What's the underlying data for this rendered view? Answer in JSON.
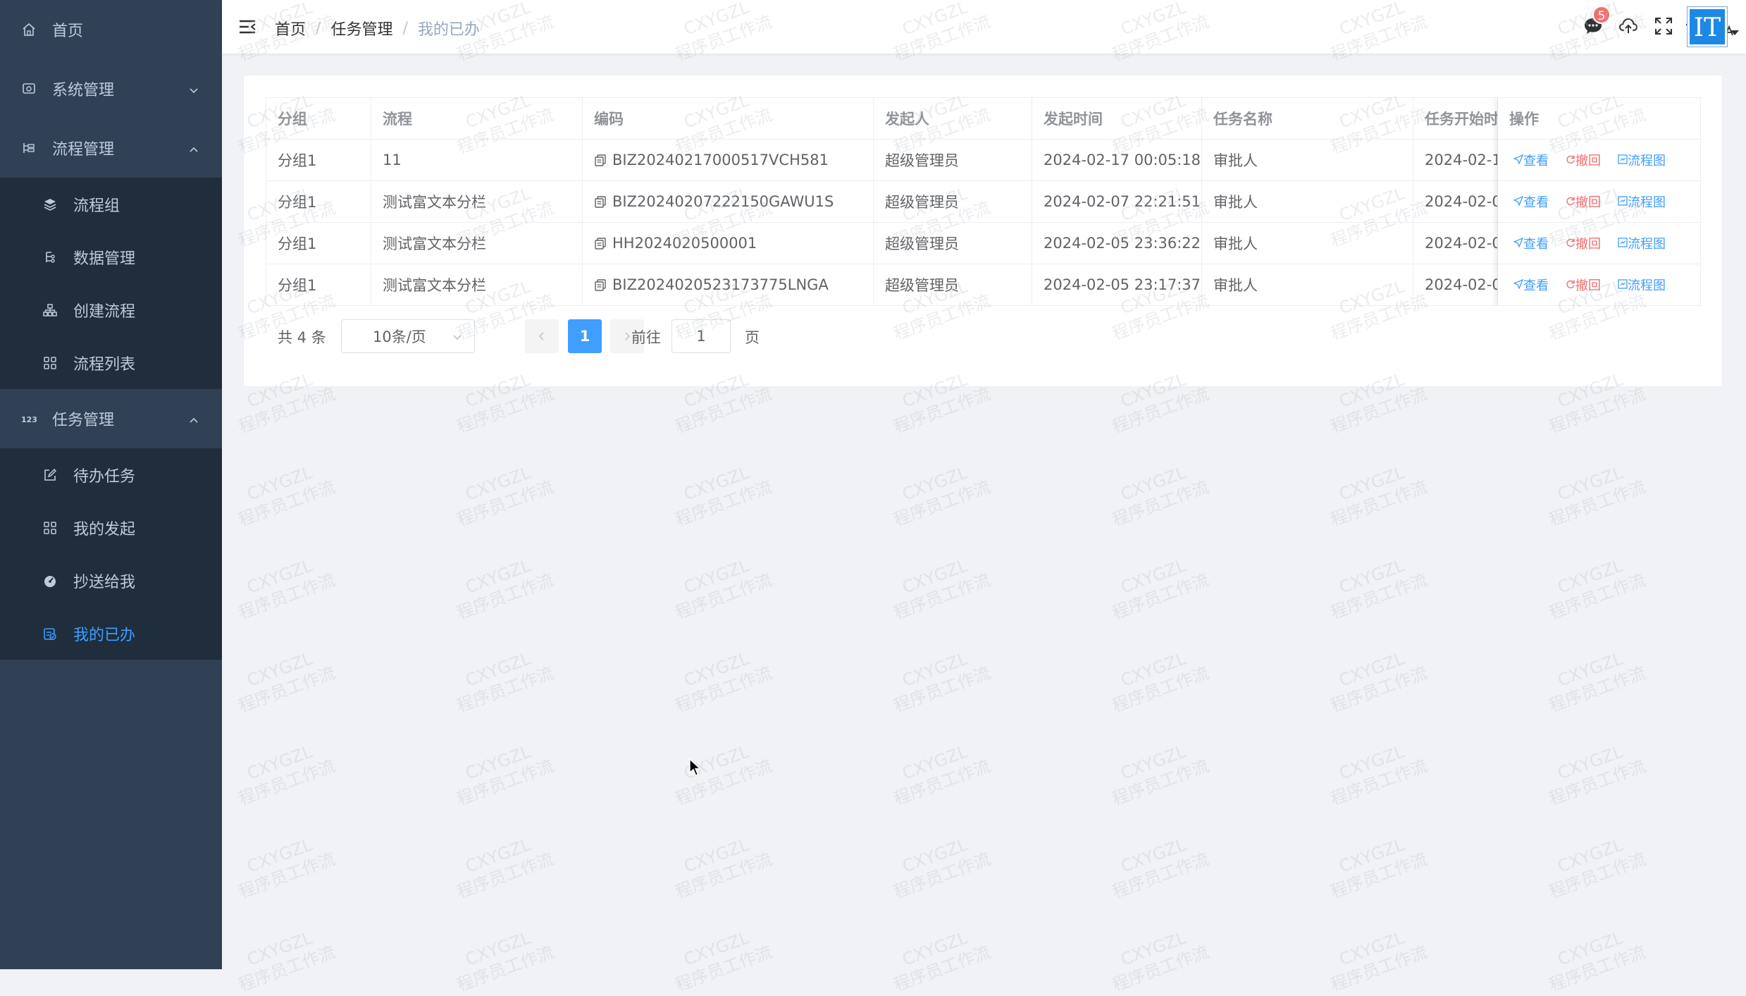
{
  "sidebar": {
    "home": "首页",
    "system": "系统管理",
    "process": "流程管理",
    "process_items": [
      "流程组",
      "数据管理",
      "创建流程",
      "流程列表"
    ],
    "task": "任务管理",
    "task_items": [
      "待办任务",
      "我的发起",
      "抄送给我",
      "我的已办"
    ],
    "active": "我的已办"
  },
  "navbar": {
    "breadcrumb": [
      "首页",
      "任务管理",
      "我的已办"
    ],
    "breadcrumb_sep": "/",
    "message_count": "5",
    "avatar_text": "IT"
  },
  "table": {
    "headers": [
      "分组",
      "流程",
      "编码",
      "发起人",
      "发起时间",
      "任务名称",
      "任务开始时",
      "操作"
    ],
    "rows": [
      {
        "group": "分组1",
        "process": "11",
        "code": "BIZ20240217000517VCH581",
        "initiator": "超级管理员",
        "start_time": "2024-02-17 00:05:18",
        "task_name": "审批人",
        "task_start": "2024-02-1"
      },
      {
        "group": "分组1",
        "process": "测试富文本分栏",
        "code": "BIZ20240207222150GAWU1S",
        "initiator": "超级管理员",
        "start_time": "2024-02-07 22:21:51",
        "task_name": "审批人",
        "task_start": "2024-02-0"
      },
      {
        "group": "分组1",
        "process": "测试富文本分栏",
        "code": "HH2024020500001",
        "initiator": "超级管理员",
        "start_time": "2024-02-05 23:36:22",
        "task_name": "审批人",
        "task_start": "2024-02-0"
      },
      {
        "group": "分组1",
        "process": "测试富文本分栏",
        "code": "BIZ2024020523173775LNGA",
        "initiator": "超级管理员",
        "start_time": "2024-02-05 23:17:37",
        "task_name": "审批人",
        "task_start": "2024-02-0"
      }
    ],
    "actions": {
      "view": "查看",
      "revoke": "撤回",
      "flow": "流程图"
    }
  },
  "pagination": {
    "total": "共 4 条",
    "page_size": "10条/页",
    "current_page": "1",
    "goto_prefix": "前往",
    "goto_value": "1",
    "goto_suffix": "页"
  },
  "watermark": {
    "line1": "CXYGZL",
    "line2": "程序员工作流"
  },
  "colors": {
    "sidebar_bg": "#304156",
    "submenu_bg": "#1f2d3d",
    "accent": "#409eff",
    "danger": "#f56c6c"
  }
}
